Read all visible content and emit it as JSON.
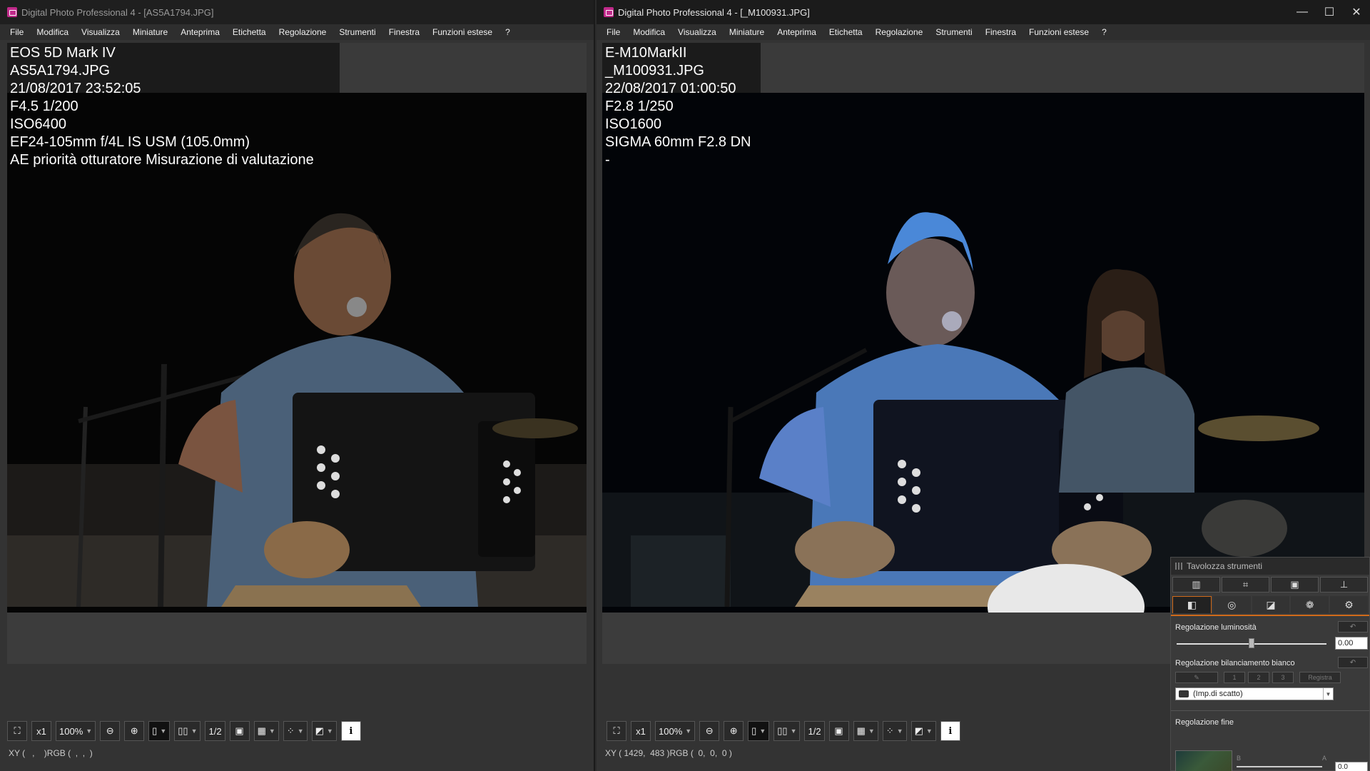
{
  "left_window": {
    "title": "Digital Photo Professional 4 - [AS5A1794.JPG]",
    "menu": [
      "File",
      "Modifica",
      "Visualizza",
      "Miniature",
      "Anteprima",
      "Etichetta",
      "Regolazione",
      "Strumenti",
      "Finestra",
      "Funzioni estese",
      "?"
    ],
    "info_lines": [
      "EOS 5D Mark IV",
      "AS5A1794.JPG",
      "21/08/2017 23:52:05",
      "F4.5 1/200",
      "ISO6400",
      "EF24-105mm f/4L IS USM (105.0mm)",
      "AE priorità otturatore Misurazione di valutazione"
    ],
    "zoom_label": "x1",
    "zoom_level": "100%",
    "page_label": "1/2",
    "status": "XY (   ,    )RGB (  ,  ,  )"
  },
  "right_window": {
    "title": "Digital Photo Professional 4 - [_M100931.JPG]",
    "menu": [
      "File",
      "Modifica",
      "Visualizza",
      "Miniature",
      "Anteprima",
      "Etichetta",
      "Regolazione",
      "Strumenti",
      "Finestra",
      "Funzioni estese",
      "?"
    ],
    "info_lines": [
      "E-M10MarkII",
      "_M100931.JPG",
      "22/08/2017 01:00:50",
      "F2.8 1/250",
      "ISO1600",
      "SIGMA 60mm F2.8 DN",
      "-"
    ],
    "zoom_label": "x1",
    "zoom_level": "100%",
    "page_label": "1/2",
    "status": "XY ( 1429,  483 )RGB (  0,  0,  0 )",
    "controls": {
      "minimize": "—",
      "maximize": "☐",
      "close": "✕"
    }
  },
  "palette": {
    "title": "Tavolozza strumenti",
    "brightness_label": "Regolazione luminosità",
    "brightness_value": "0.00",
    "brightness_level": 0.5,
    "wb_label": "Regolazione bilanciamento bianco",
    "wb_buttons": [
      "1",
      "2",
      "3"
    ],
    "wb_register": "Registra",
    "wb_select": "(Imp.di scatto)",
    "fine_label": "Regolazione fine",
    "fine_value": "0.0",
    "fine_b": "B",
    "fine_a": "A"
  }
}
